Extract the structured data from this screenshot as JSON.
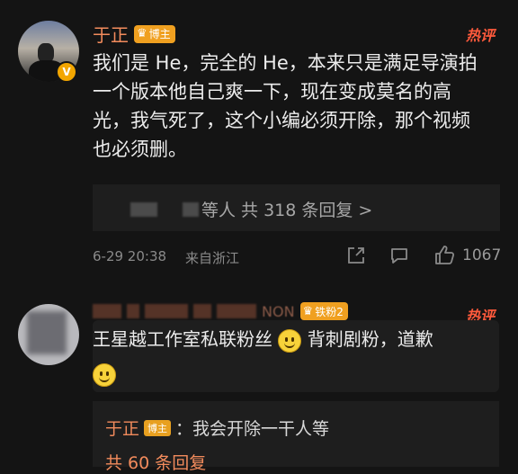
{
  "comment1": {
    "username": "于正",
    "badge_label": "博主",
    "hot_label": "热评",
    "verified_icon": "v-icon",
    "content_lines": [
      "我们是 He，完全的 He，本来只是满足导演拍",
      "一个版本他自己爽一下，现在变成莫名的高",
      "光，我气死了，这个小编必须开除，那个视频",
      "也必须删。"
    ],
    "reply_summary": "等人  共 318 条回复 >",
    "date": "6-29 20:38",
    "location": "来自浙江",
    "like_count": "1067"
  },
  "comment2": {
    "username_partial": "NON",
    "badge_label": "铁粉2",
    "hot_label": "热评",
    "content_line1_a": "王星越工作室私联粉丝",
    "content_line1_b": "背刺剧粉，道歉"
  },
  "subreply": {
    "username": "于正",
    "badge_label": "博主",
    "text": "：我会开除一干人等",
    "summary": "共 60 条回复"
  },
  "colors": {
    "background": "#141414",
    "username": "#f28b5c",
    "hot": "#ff5a3c",
    "badge": "#f0a020"
  }
}
